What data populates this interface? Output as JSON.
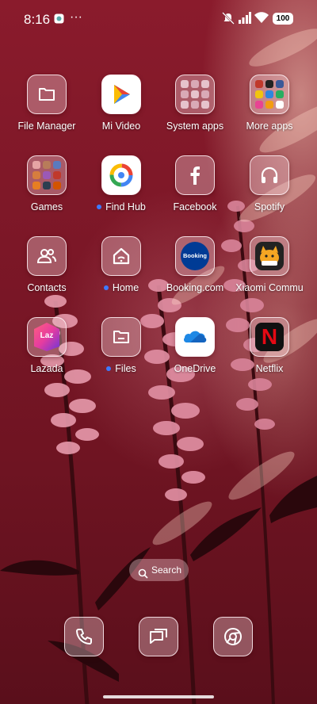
{
  "status_bar": {
    "time": "8:16",
    "battery": "100"
  },
  "apps": [
    {
      "label": "File Manager",
      "icon": "folder-icon"
    },
    {
      "label": "Mi Video",
      "icon": "play-icon"
    },
    {
      "label": "System apps",
      "icon": "folder-grid-icon"
    },
    {
      "label": "More apps",
      "icon": "folder-grid-icon"
    },
    {
      "label": "Games",
      "icon": "folder-grid-icon"
    },
    {
      "label": "Find Hub",
      "icon": "find-hub-icon",
      "new": true
    },
    {
      "label": "Facebook",
      "icon": "facebook-icon"
    },
    {
      "label": "Spotify",
      "icon": "headphones-icon"
    },
    {
      "label": "Contacts",
      "icon": "contacts-icon"
    },
    {
      "label": "Home",
      "icon": "home-icon",
      "new": true
    },
    {
      "label": "Booking.com",
      "icon": "booking-icon",
      "text": "Booking"
    },
    {
      "label": "Xiaomi Commu",
      "icon": "xiaomi-community-icon"
    },
    {
      "label": "Lazada",
      "icon": "lazada-icon",
      "text": "Laz"
    },
    {
      "label": "Files",
      "icon": "files-icon",
      "new": true
    },
    {
      "label": "OneDrive",
      "icon": "cloud-icon"
    },
    {
      "label": "Netflix",
      "icon": "netflix-icon",
      "text": "N"
    }
  ],
  "search": {
    "label": "Search"
  },
  "dock": [
    {
      "icon": "phone-icon"
    },
    {
      "icon": "messages-icon"
    },
    {
      "icon": "chrome-icon"
    }
  ],
  "colors": {
    "accent_dot": "#3d7bff",
    "netflix_red": "#e50914",
    "booking_blue": "#003b95"
  }
}
